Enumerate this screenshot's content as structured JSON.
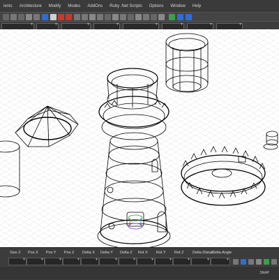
{
  "menu": [
    "ients",
    "Architecture",
    "Modify",
    "Modes",
    "AddOns",
    "Ruby .Net Scripts",
    "Options",
    "Window",
    "Help"
  ],
  "status": {
    "fields": [
      "Size Z",
      "Pos X",
      "Pos Y",
      "Pos Z",
      "Delta X",
      "Delta Y",
      "Delta Z",
      "Rot X",
      "Rot Y",
      "Rot Z",
      "Delta Distan",
      "Delta Angle"
    ],
    "snap_label": "SNAP"
  },
  "colors": {
    "toolbar_bg": "#444444",
    "viewport_bg": "#ffffff",
    "accent_blue": "#2e6ecf",
    "accent_red": "#c8382b",
    "accent_green": "#3aa04a"
  }
}
